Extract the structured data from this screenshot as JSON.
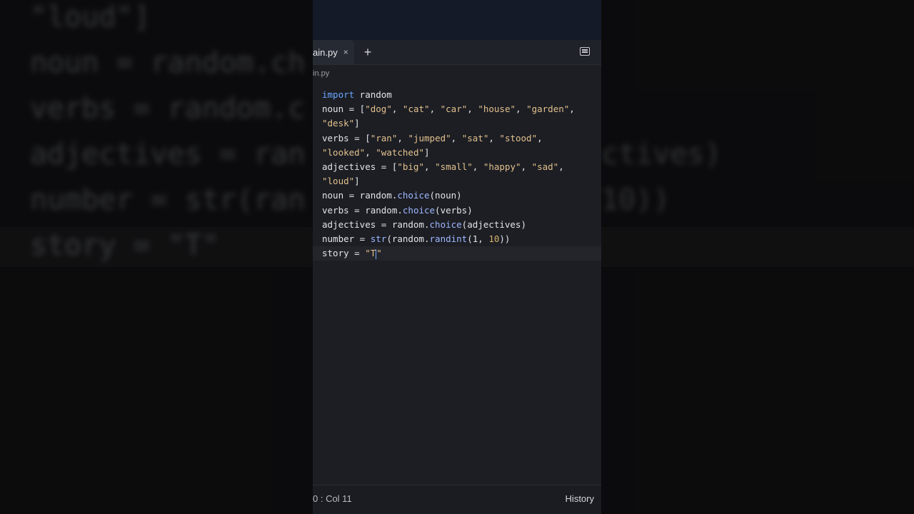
{
  "background": {
    "lines": [
      "\"loud\"]",
      "noun = random.ch",
      "verbs = random.c",
      "adjectives = ran",
      "number = str(ran",
      "story = \"T\""
    ],
    "right_fragments": [
      "ctives)",
      "10))"
    ]
  },
  "editor": {
    "tab_label": "ain.py",
    "tab_close": "×",
    "add_tab": "+",
    "breadcrumb": "in.py",
    "code": {
      "l1_kw": "import",
      "l1_rest": " random",
      "l2_a": "noun = [",
      "l2_s1": "\"dog\"",
      "l2_s2": "\"cat\"",
      "l2_s3": "\"car\"",
      "l2_s4": "\"house\"",
      "l2_s5": "\"garden\"",
      "l3_s1": "\"desk\"",
      "l3_end": "]",
      "l4_a": "verbs = [",
      "l4_s1": "\"ran\"",
      "l4_s2": "\"jumped\"",
      "l4_s3": "\"sat\"",
      "l4_s4": "\"stood\"",
      "l5_s1": "\"looked\"",
      "l5_s2": "\"watched\"",
      "l5_end": "]",
      "l6_a": "adjectives = [",
      "l6_s1": "\"big\"",
      "l6_s2": "\"small\"",
      "l6_s3": "\"happy\"",
      "l6_s4": "\"sad\"",
      "l7_s1": "\"loud\"",
      "l7_end": "]",
      "l8_a": "noun = random.",
      "l8_fn": "choice",
      "l8_b": "(noun)",
      "l9_a": "verbs = random.",
      "l9_fn": "choice",
      "l9_b": "(verbs)",
      "l10_a": "adjectives = random.",
      "l10_fn": "choice",
      "l10_b": "(adjectives)",
      "l11_a": "number = ",
      "l11_fn1": "str",
      "l11_b": "(random.",
      "l11_fn2": "randint",
      "l11_c": "(1, ",
      "l11_num": "10",
      "l11_d": "))",
      "l12_a": "story = ",
      "l12_s": "\"T",
      "l12_q": "\""
    }
  },
  "footer": {
    "position": "0 : Col 11",
    "history": "History"
  }
}
